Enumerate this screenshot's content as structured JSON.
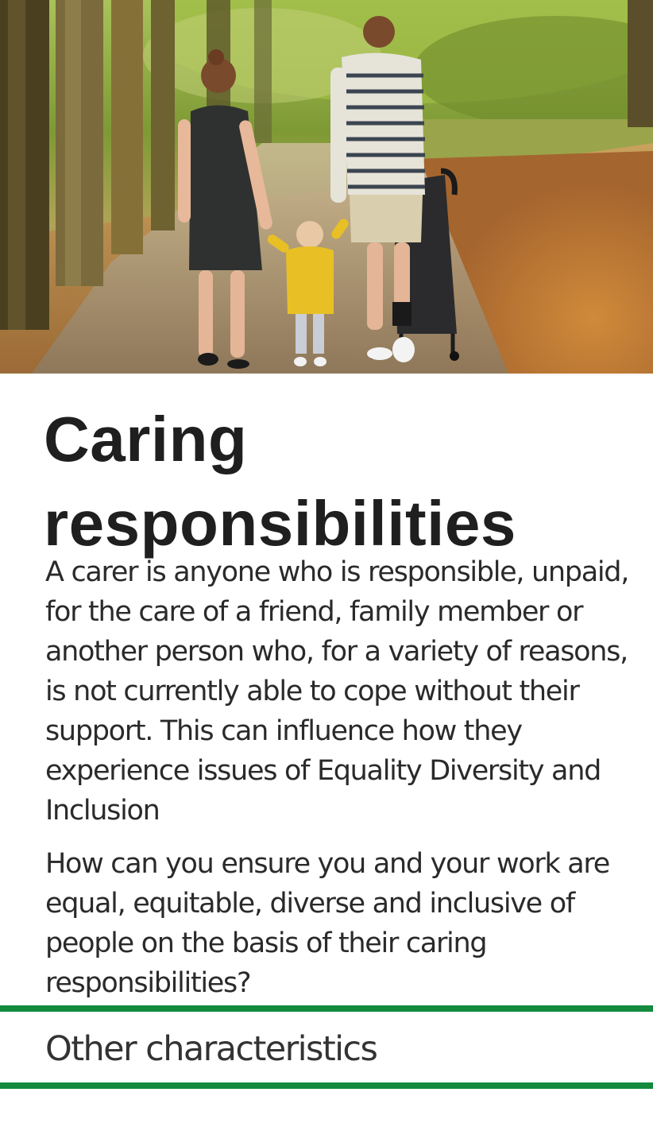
{
  "hero": {
    "image": "family-walking-in-autumn-park-photo"
  },
  "heading": {
    "line1": "Caring",
    "line2": "responsibilities"
  },
  "body": {
    "paragraph1": "A carer is anyone who is responsible, unpaid, for the care of a friend, family member or another person who, for a variety of reasons, is not currently able to cope without their support. This can influence how they experience issues of Equality Diversity and Inclusion",
    "paragraph2": "How can you  ensure you and your work are equal, equitable, diverse and inclusive of people on the basis of their caring responsibilities?"
  },
  "footer": {
    "link_label": "Other characteristics"
  },
  "colors": {
    "accent": "#138a3e",
    "text": "#1f1f1f"
  }
}
